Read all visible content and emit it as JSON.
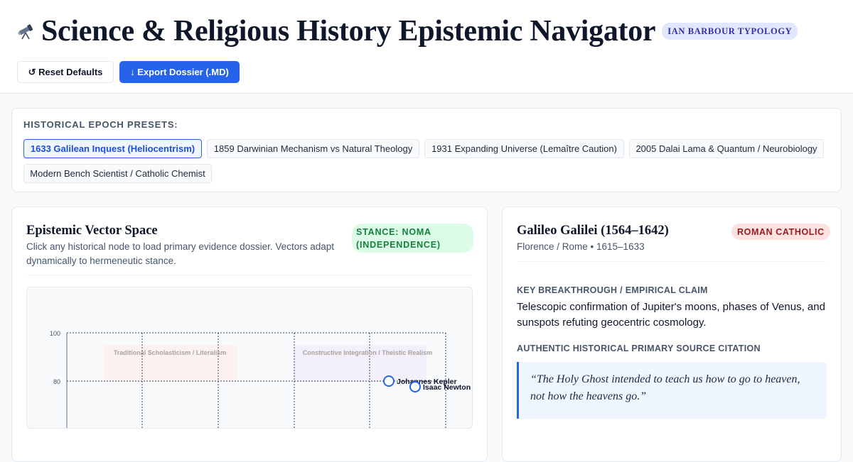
{
  "header": {
    "icon": "telescope-icon",
    "title": "Science & Religious History Epistemic Navigator",
    "typology_badge": "IAN BARBOUR TYPOLOGY",
    "reset_label": "↺ Reset Defaults",
    "export_label": "↓ Export Dossier (.MD)"
  },
  "presets": {
    "heading": "HISTORICAL EPOCH PRESETS:",
    "items": [
      {
        "label": "1633 Galilean Inquest (Heliocentrism)",
        "active": true
      },
      {
        "label": "1859 Darwinian Mechanism vs Natural Theology",
        "active": false
      },
      {
        "label": "1931 Expanding Universe (Lemaître Caution)",
        "active": false
      },
      {
        "label": "2005 Dalai Lama & Quantum / Neurobiology",
        "active": false
      },
      {
        "label": "Modern Bench Scientist / Catholic Chemist",
        "active": false
      }
    ]
  },
  "vector_space": {
    "title": "Epistemic Vector Space",
    "description": "Click any historical node to load primary evidence dossier. Vectors adapt dynamically to hermeneutic stance.",
    "stance_badge": "STANCE: NOMA (INDEPENDENCE)",
    "chart": {
      "y_ticks": [
        "100",
        "80"
      ],
      "zones": [
        "Traditional Scholasticism / Literalism",
        "Constructive Integration / Theistic Realism"
      ],
      "nodes": [
        {
          "label": "Johannes Kepler"
        },
        {
          "label": "Isaac Newton"
        }
      ]
    }
  },
  "colors": {
    "accent": "#2563eb",
    "stance_bg": "#dcfce7",
    "tradition_bg": "#fee2e2",
    "typology_bg": "#e0e7ff"
  },
  "dossier": {
    "figure_name": "Galileo Galilei (1564–1642)",
    "tradition_badge": "ROMAN CATHOLIC",
    "meta": "Florence / Rome • 1615–1633",
    "breakthrough_heading": "KEY BREAKTHROUGH / EMPIRICAL CLAIM",
    "breakthrough_text": "Telescopic confirmation of Jupiter's moons, phases of Venus, and sunspots refuting geocentric cosmology.",
    "citation_heading": "AUTHENTIC HISTORICAL PRIMARY SOURCE CITATION",
    "quote": "“The Holy Ghost intended to teach us how to go to heaven, not how the heavens go.”"
  }
}
